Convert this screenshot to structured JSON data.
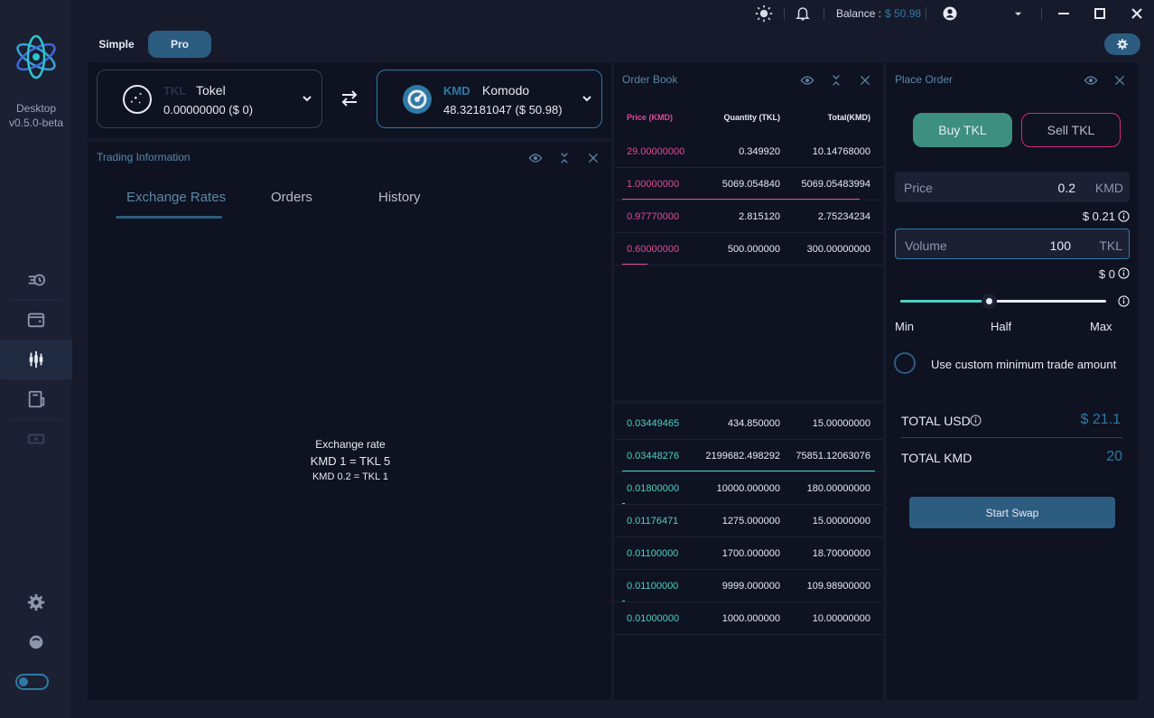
{
  "app": {
    "name": "Desktop",
    "version": "v0.5.0-beta"
  },
  "titlebar": {
    "balance_label": "Balance :",
    "balance_value": "$ 50.98"
  },
  "mode": {
    "simple": "Simple",
    "pro": "Pro"
  },
  "ticker": {
    "base": {
      "symbol": "TKL",
      "name": "Tokel",
      "amount": "0.00000000  ($ 0)"
    },
    "rel": {
      "symbol": "KMD",
      "name": "Komodo",
      "amount": "48.32181047  ($ 50.98)"
    }
  },
  "trading": {
    "title": "Trading Information",
    "tabs": [
      "Exchange Rates",
      "Orders",
      "History"
    ],
    "rate": {
      "label": "Exchange rate",
      "line1": "KMD 1 = TKL 5",
      "line2": "KMD 0.2 = TKL 1"
    }
  },
  "orderbook": {
    "title": "Order Book",
    "headers": {
      "price": "Price (KMD)",
      "quantity": "Quantity (TKL)",
      "total": "Total(KMD)"
    },
    "asks": [
      {
        "price": "29.00000000",
        "quantity": "0.349920",
        "total": "10.14768000",
        "depth": 0.0
      },
      {
        "price": "1.00000000",
        "quantity": "5069.054840",
        "total": "5069.05483994",
        "depth": 0.94
      },
      {
        "price": "0.97770000",
        "quantity": "2.815120",
        "total": "2.75234234",
        "depth": 0.0
      },
      {
        "price": "0.60000000",
        "quantity": "500.000000",
        "total": "300.00000000",
        "depth": 0.1
      }
    ],
    "bids": [
      {
        "price": "0.03449465",
        "quantity": "434.850000",
        "total": "15.00000000",
        "depth": 0.0
      },
      {
        "price": "0.03448276",
        "quantity": "2199682.498292",
        "total": "75851.12063076",
        "depth": 1.0
      },
      {
        "price": "0.01800000",
        "quantity": "10000.000000",
        "total": "180.00000000",
        "depth": 0.01
      },
      {
        "price": "0.01176471",
        "quantity": "1275.000000",
        "total": "15.00000000",
        "depth": 0.0
      },
      {
        "price": "0.01100000",
        "quantity": "1700.000000",
        "total": "18.70000000",
        "depth": 0.0
      },
      {
        "price": "0.01100000",
        "quantity": "9999.000000",
        "total": "109.98900000",
        "depth": 0.01
      },
      {
        "price": "0.01000000",
        "quantity": "1000.000000",
        "total": "10.00000000",
        "depth": 0.0
      }
    ]
  },
  "place_order": {
    "title": "Place Order",
    "buy": "Buy TKL",
    "sell": "Sell TKL",
    "price_label": "Price",
    "price_value": "0.2",
    "price_unit": "KMD",
    "price_usd": "$ 0.21",
    "volume_label": "Volume",
    "volume_value": "100",
    "volume_unit": "TKL",
    "volume_usd": "$ 0",
    "slider": {
      "min": "Min",
      "half": "Half",
      "max": "Max",
      "value": 0.43
    },
    "custom_min": "Use custom minimum trade amount",
    "total_usd_label": "TOTAL USD",
    "total_usd_value": "$ 21.1",
    "total_kmd_label": "TOTAL KMD",
    "total_kmd_value": "20",
    "start_swap": "Start Swap"
  },
  "colors": {
    "accent": "#2f7aa5",
    "buy": "#3d8f80",
    "sell": "#d4287f",
    "bid": "#4fd1c5",
    "ask": "#e04b9a"
  }
}
